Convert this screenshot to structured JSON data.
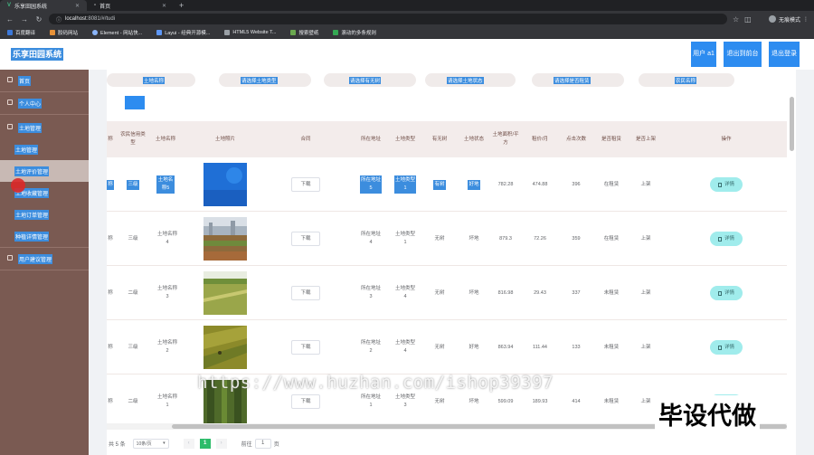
{
  "browser": {
    "tabs": [
      {
        "label": "乐享田园系统",
        "active": true
      },
      {
        "label": "首页",
        "active": false
      }
    ],
    "url_host": "localhost",
    "url_rest": ":8081/#/tudi",
    "profile": "无痕模式",
    "bookmarks": [
      "百度翻译",
      "胶码网站",
      "Element - 网站快...",
      "Layui - 经典开源模...",
      "HTML5 Website T...",
      "搜索壁纸",
      "滚动的多条规则"
    ]
  },
  "header": {
    "brand": "乐享田园系统",
    "user": "用户 a1",
    "back_label": "退出到前台",
    "logout_label": "退出登录"
  },
  "sidebar": {
    "items": [
      {
        "label": "首页",
        "icon": "home-icon"
      },
      {
        "label": "个人中心",
        "icon": "user-icon"
      },
      {
        "label": "土地管理",
        "icon": "land-icon"
      },
      {
        "label": "土地管理",
        "icon": ""
      },
      {
        "label": "土地评价管理",
        "icon": ""
      },
      {
        "label": "土地收藏管理",
        "icon": ""
      },
      {
        "label": "土地订单管理",
        "icon": ""
      },
      {
        "label": "种植详情管理",
        "icon": ""
      },
      {
        "label": "用户建议管理",
        "icon": "suggest-icon"
      }
    ]
  },
  "search": {
    "land_name": "土地名称",
    "land_type": "请选择土地类型",
    "has_trees": "请选择有无树",
    "land_status": "请选择土地状态",
    "rented": "请选择是否租赁",
    "farmer_name": "农民名称"
  },
  "table": {
    "headers": [
      "称",
      "农民信用类型",
      "土地名称",
      "土地照片",
      "合同",
      "所在地址",
      "土地类型",
      "有无树",
      "土地状态",
      "土地面积/平方",
      "租价/月",
      "点击次数",
      "是否租赁",
      "是否上架",
      "操作"
    ],
    "rows": [
      {
        "name_tail": "称",
        "credit": "三级",
        "land_name": "土地名称5",
        "download": "下载",
        "address": "所在地址5",
        "land_type": "土地类型1",
        "trees": "有树",
        "status": "好地",
        "area": "782.28",
        "rent": "474.88",
        "clicks": "396",
        "rented": "在租赁",
        "listed": "上架",
        "action": "详情"
      },
      {
        "name_tail": "称",
        "credit": "三级",
        "land_name": "土地名称4",
        "download": "下载",
        "address": "所在地址4",
        "land_type": "土地类型1",
        "trees": "无树",
        "status": "坏地",
        "area": "879.3",
        "rent": "72.26",
        "clicks": "359",
        "rented": "在租赁",
        "listed": "上架",
        "action": "详情"
      },
      {
        "name_tail": "称",
        "credit": "二级",
        "land_name": "土地名称3",
        "download": "下载",
        "address": "所在地址3",
        "land_type": "土地类型4",
        "trees": "无树",
        "status": "坏地",
        "area": "816.98",
        "rent": "29.43",
        "clicks": "337",
        "rented": "未租赁",
        "listed": "上架",
        "action": "详情"
      },
      {
        "name_tail": "称",
        "credit": "三级",
        "land_name": "土地名称2",
        "download": "下载",
        "address": "所在地址2",
        "land_type": "土地类型4",
        "trees": "无树",
        "status": "好地",
        "area": "863.94",
        "rent": "111.44",
        "clicks": "133",
        "rented": "未租赁",
        "listed": "上架",
        "action": "详情"
      },
      {
        "name_tail": "称",
        "credit": "二级",
        "land_name": "土地名称1",
        "download": "下载",
        "address": "所在地址1",
        "land_type": "土地类型3",
        "trees": "无树",
        "status": "坏地",
        "area": "599.09",
        "rent": "189.93",
        "clicks": "414",
        "rented": "未租赁",
        "listed": "上架",
        "action": "详情"
      }
    ]
  },
  "pagination": {
    "total": "共 5 条",
    "page_size": "10条/页",
    "current": "1",
    "goto_label": "前往",
    "goto_value": "1",
    "page_unit": "页"
  },
  "watermark": "https://www.huzhan.com/ishop39397",
  "corner_mark": "毕设代做",
  "colors": {
    "sidebar_bg": "#7a5a52",
    "highlight": "#3c8dde",
    "primary_button": "#2d8cf0",
    "detail_button": "#a0ecec",
    "active_page": "#2dbc6a"
  }
}
